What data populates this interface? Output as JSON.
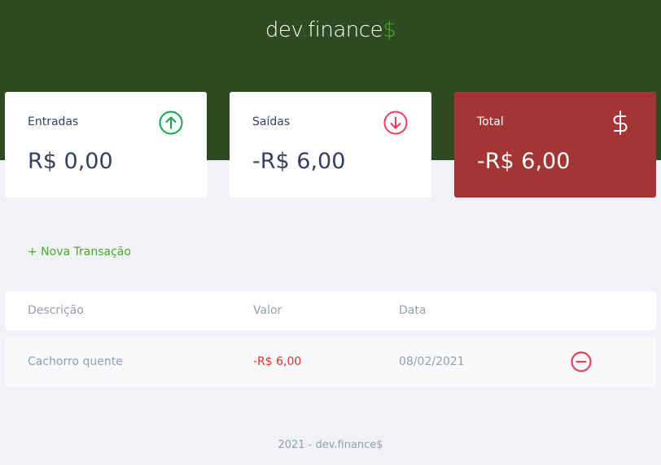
{
  "header": {
    "logo_main": "dev",
    "logo_dot": ".",
    "logo_name": "finance",
    "logo_symbol": "$"
  },
  "cards": {
    "income": {
      "label": "Entradas",
      "value": "R$ 0,00",
      "icon": "arrow-up-circle-icon"
    },
    "expense": {
      "label": "Saídas",
      "value": "-R$ 6,00",
      "icon": "arrow-down-circle-icon"
    },
    "total": {
      "label": "Total",
      "value": "-R$ 6,00",
      "icon": "dollar-sign-icon"
    }
  },
  "actions": {
    "new_transaction": "+ Nova Transação"
  },
  "table": {
    "headers": [
      "Descrição",
      "Valor",
      "Data"
    ],
    "rows": [
      {
        "description": "Cachorro quente",
        "amount": "-R$ 6,00",
        "date": "08/02/2021",
        "remove_icon": "minus-circle-icon"
      }
    ]
  },
  "footer": {
    "text": "2021 - dev.finance$"
  },
  "colors": {
    "header_bg": "#2d4a22",
    "accent_green": "#49aa26",
    "total_bg": "#a33535",
    "expense_red": "#e92929",
    "text_dark": "#363f5f",
    "text_muted": "#969cb3"
  }
}
